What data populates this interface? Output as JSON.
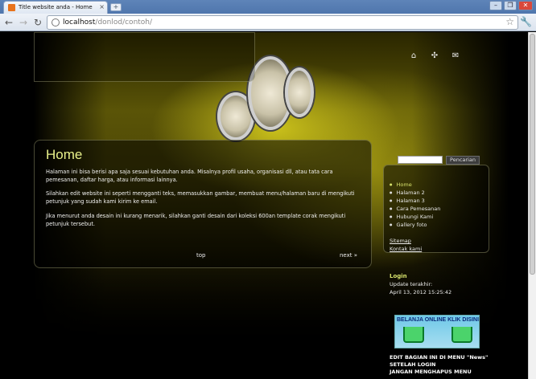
{
  "browser": {
    "tab_title": "Title website anda - Home",
    "tab_close": "×",
    "new_tab": "+",
    "url_host": "localhost",
    "url_path": "/donlod/contoh/"
  },
  "content": {
    "title": "Home",
    "paragraphs": [
      "Halaman ini bisa berisi apa saja sesuai kebutuhan anda. Misalnya profil usaha, organisasi dll, atau tata cara pemesanan, daftar harga, atau informasi lainnya.",
      "Silahkan edit website ini seperti mengganti teks, memasukkan gambar, membuat menu/halaman baru di mengikuti petunjuk yang sudah kami kirim ke email.",
      "Jika menurut anda desain ini kurang menarik, silahkan ganti desain dari koleksi 600an template corak mengikuti petunjuk tersebut."
    ],
    "top_link": "top",
    "next_link": "next »"
  },
  "sidebar": {
    "search_button": "Pencarian",
    "menu": [
      {
        "label": "Home",
        "active": true
      },
      {
        "label": "Halaman 2",
        "active": false
      },
      {
        "label": "Halaman 3",
        "active": false
      },
      {
        "label": "Cara Pemesanan",
        "active": false
      },
      {
        "label": "Hubungi Kami",
        "active": false
      },
      {
        "label": "Gallery foto",
        "active": false
      }
    ],
    "sitemap": "Sitemap",
    "contact": "Kontak kami",
    "login_title": "Login",
    "updated_label": "Update terakhir:",
    "updated_value": "April 13, 2012 15:25:42",
    "banner_text": "BELANJA ONLINE KLIK DISINI",
    "news_lines": [
      "EDIT BAGIAN INI DI MENU \"News\"",
      "SETELAH LOGIN",
      "JANGAN MENGHAPUS MENU"
    ]
  },
  "colors": {
    "accent": "#d8e36c",
    "title": "#e8f08a"
  }
}
